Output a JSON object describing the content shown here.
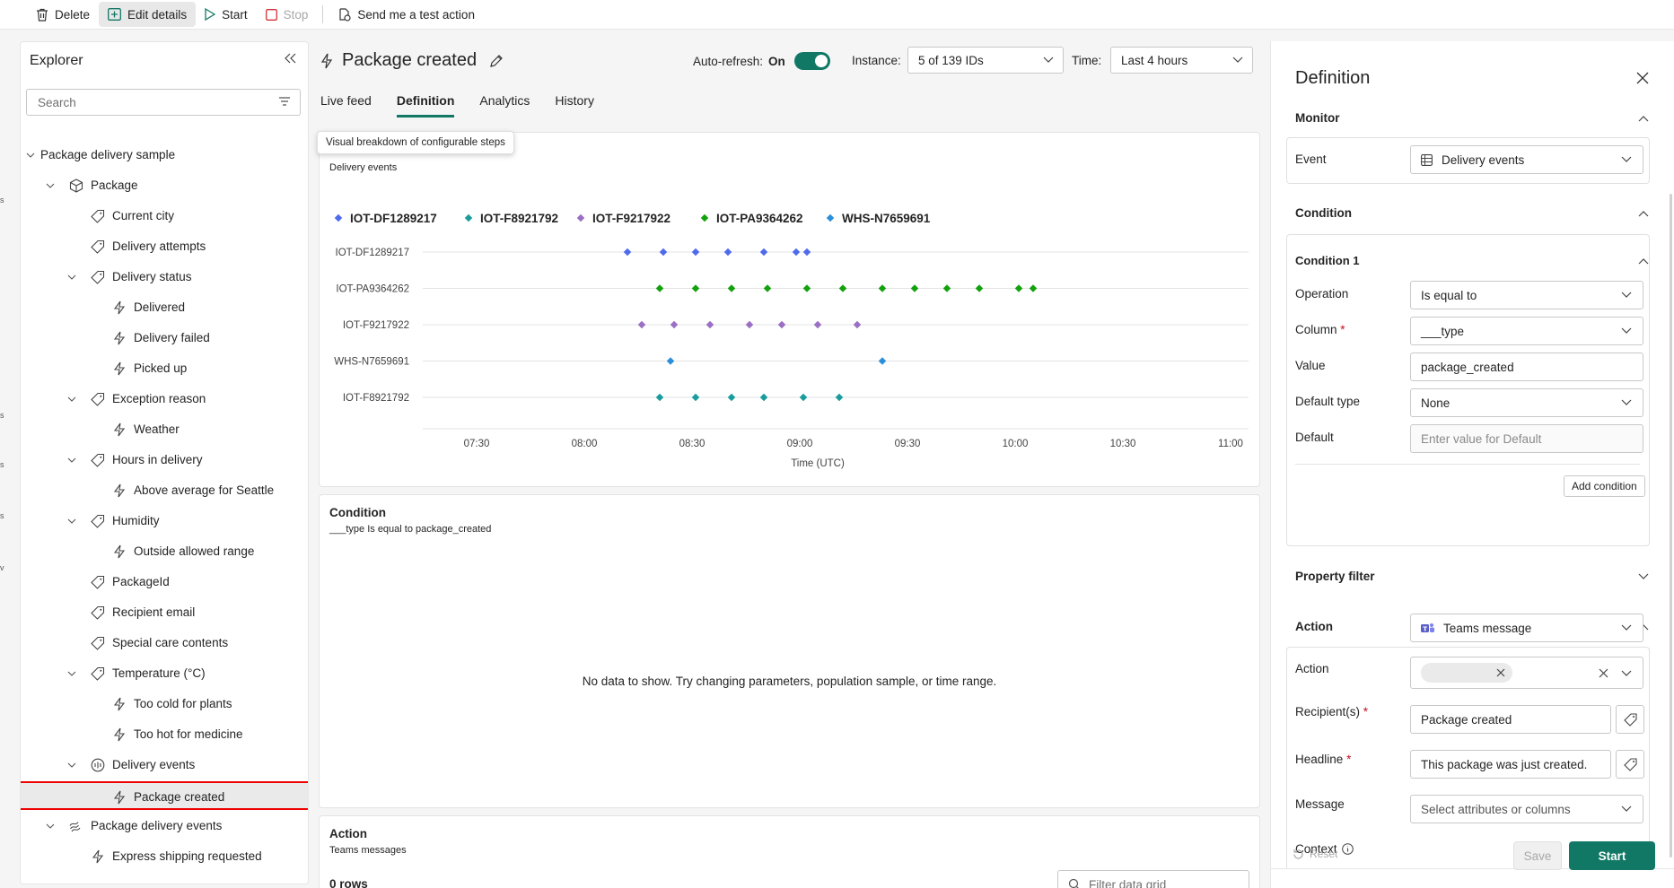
{
  "toolbar": {
    "delete": "Delete",
    "edit_details": "Edit details",
    "start": "Start",
    "stop": "Stop",
    "send_test": "Send me a test action"
  },
  "explorer": {
    "title": "Explorer",
    "search_placeholder": "Search",
    "items": [
      {
        "label": "Package delivery sample",
        "icon": "none",
        "level": 0,
        "chevron": "down"
      },
      {
        "label": "Package",
        "icon": "cube-icon",
        "level": 1,
        "chevron": "down"
      },
      {
        "label": "Current city",
        "icon": "tag-icon",
        "level": 2,
        "chevron": "none"
      },
      {
        "label": "Delivery attempts",
        "icon": "tag-icon",
        "level": 2,
        "chevron": "none"
      },
      {
        "label": "Delivery status",
        "icon": "tag-icon",
        "level": 2,
        "chevron": "down"
      },
      {
        "label": "Delivered",
        "icon": "flash-icon",
        "level": 3,
        "chevron": "none"
      },
      {
        "label": "Delivery failed",
        "icon": "flash-icon",
        "level": 3,
        "chevron": "none"
      },
      {
        "label": "Picked up",
        "icon": "flash-icon",
        "level": 3,
        "chevron": "none"
      },
      {
        "label": "Exception reason",
        "icon": "tag-icon",
        "level": 2,
        "chevron": "down"
      },
      {
        "label": "Weather",
        "icon": "flash-icon",
        "level": 3,
        "chevron": "none"
      },
      {
        "label": "Hours in delivery",
        "icon": "tag-icon",
        "level": 2,
        "chevron": "down"
      },
      {
        "label": "Above average for Seattle",
        "icon": "flash-icon",
        "level": 3,
        "chevron": "none"
      },
      {
        "label": "Humidity",
        "icon": "tag-icon",
        "level": 2,
        "chevron": "down"
      },
      {
        "label": "Outside allowed range",
        "icon": "flash-icon",
        "level": 3,
        "chevron": "none"
      },
      {
        "label": "PackageId",
        "icon": "tag-icon",
        "level": 2,
        "chevron": "none"
      },
      {
        "label": "Recipient email",
        "icon": "tag-icon",
        "level": 2,
        "chevron": "none"
      },
      {
        "label": "Special care contents",
        "icon": "tag-icon",
        "level": 2,
        "chevron": "none"
      },
      {
        "label": "Temperature (°C)",
        "icon": "tag-icon",
        "level": 2,
        "chevron": "down"
      },
      {
        "label": "Too cold for plants",
        "icon": "flash-icon",
        "level": 3,
        "chevron": "none"
      },
      {
        "label": "Too hot for medicine",
        "icon": "flash-icon",
        "level": 3,
        "chevron": "none"
      },
      {
        "label": "Delivery events",
        "icon": "stream-icon",
        "level": 2,
        "chevron": "down"
      },
      {
        "label": "Package created",
        "icon": "flash-icon",
        "level": 3,
        "chevron": "none",
        "selected": true
      },
      {
        "label": "Package delivery events",
        "icon": "eventstream-icon",
        "level": 1,
        "chevron": "down"
      },
      {
        "label": "Express shipping requested",
        "icon": "flash-icon",
        "level": 2,
        "chevron": "none"
      }
    ]
  },
  "header": {
    "title": "Package created",
    "auto_refresh_label": "Auto-refresh:",
    "auto_refresh_value": "On",
    "instance_label": "Instance:",
    "instance_value": "5 of 139 IDs",
    "time_label": "Time:",
    "time_value": "Last 4 hours"
  },
  "tabs": [
    "Live feed",
    "Definition",
    "Analytics",
    "History"
  ],
  "tooltip": "Visual breakdown of configurable steps",
  "monitor_card": {
    "title": "Monitor",
    "subtitle": "Delivery events"
  },
  "chart_data": {
    "type": "scatter",
    "title": "",
    "xlabel": "Time (UTC)",
    "ylabel": "",
    "x_ticks": [
      "07:30",
      "08:00",
      "08:30",
      "09:00",
      "09:30",
      "10:00",
      "10:30",
      "11:00"
    ],
    "xlim": [
      "07:15",
      "11:05"
    ],
    "grid": true,
    "legend_position": "top-left",
    "series": [
      {
        "name": "IOT-DF1289217",
        "color": "#4f6bed",
        "row": "IOT-DF1289217",
        "x": [
          "08:12",
          "08:22",
          "08:31",
          "08:40",
          "08:50",
          "08:59",
          "09:02"
        ]
      },
      {
        "name": "IOT-F8921792",
        "color": "#1a9c9c",
        "row": "IOT-F8921792",
        "x": [
          "08:21",
          "08:31",
          "08:41",
          "08:50",
          "09:01",
          "09:11"
        ]
      },
      {
        "name": "IOT-F9217922",
        "color": "#9a6fc4",
        "row": "IOT-F9217922",
        "x": [
          "08:16",
          "08:25",
          "08:35",
          "08:46",
          "08:55",
          "09:05",
          "09:16"
        ]
      },
      {
        "name": "IOT-PA9364262",
        "color": "#13a10e",
        "row": "IOT-PA9364262",
        "x": [
          "08:21",
          "08:31",
          "08:41",
          "08:51",
          "09:02",
          "09:12",
          "09:23",
          "09:32",
          "09:41",
          "09:50",
          "10:01",
          "10:05"
        ]
      },
      {
        "name": "WHS-N7659691",
        "color": "#2b8fd9",
        "row": "WHS-N7659691",
        "x": [
          "08:24",
          "09:23"
        ]
      }
    ],
    "rows": [
      "IOT-DF1289217",
      "IOT-PA9364262",
      "IOT-F9217922",
      "WHS-N7659691",
      "IOT-F8921792"
    ]
  },
  "condition_card": {
    "title": "Condition",
    "subtitle": "___type Is equal to package_created",
    "empty_message": "No data to show. Try changing parameters, population sample, or time range."
  },
  "action_card": {
    "title": "Action",
    "subtitle": "Teams messages",
    "rows_count": "0 rows",
    "filter_placeholder": "Filter data grid"
  },
  "definition": {
    "title": "Definition",
    "monitor_section": "Monitor",
    "event_label": "Event",
    "event_value": "Delivery events",
    "condition_section": "Condition",
    "condition1_title": "Condition 1",
    "operation_label": "Operation",
    "operation_value": "Is equal to",
    "column_label": "Column",
    "column_value": "___type",
    "value_label": "Value",
    "value_value": "package_created",
    "default_type_label": "Default type",
    "default_type_value": "None",
    "default_label": "Default",
    "default_placeholder": "Enter value for Default",
    "add_condition": "Add condition",
    "property_filter_section": "Property filter",
    "action_section": "Action",
    "action_label": "Action",
    "action_value": "Teams message",
    "recipients_label": "Recipient(s)",
    "headline_label": "Headline",
    "headline_value": "Package created",
    "message_label": "Message",
    "message_value": "This package was just created.",
    "context_label": "Context",
    "context_placeholder": "Select attributes or columns",
    "reset": "Reset",
    "save": "Save",
    "start": "Start"
  },
  "colors": {
    "accent": "#117865",
    "selection_outline": "#ee0000"
  }
}
